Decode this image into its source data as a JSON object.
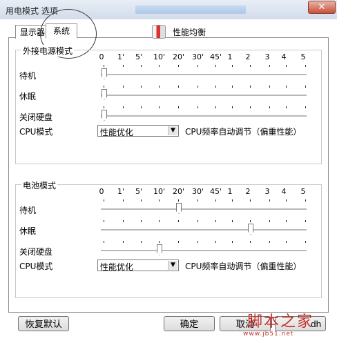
{
  "window": {
    "title": "用电模式 选项",
    "close_symbol": "✕"
  },
  "tabs": [
    {
      "label": "显示器"
    },
    {
      "label": "系统"
    }
  ],
  "header": {
    "label": "性能均衡",
    "icon": "power-balance-icon"
  },
  "tick_labels": [
    "0",
    "1'",
    "5'",
    "10'",
    "20'",
    "30'",
    "45'",
    "1",
    "2",
    "3",
    "4",
    "5"
  ],
  "ac_group": {
    "title": "外接电源模式",
    "rows": [
      {
        "label": "待机",
        "tick_index": 0
      },
      {
        "label": "休眠",
        "tick_index": 0
      },
      {
        "label": "关闭硬盘",
        "tick_index": 0
      }
    ],
    "cpu_label": "CPU模式",
    "cpu_selected": "性能优化",
    "cpu_desc": "CPU频率自动调节（偏重性能）"
  },
  "battery_group": {
    "title": "电池模式",
    "rows": [
      {
        "label": "待机",
        "tick_index": 4
      },
      {
        "label": "休眠",
        "tick_index": 8
      },
      {
        "label": "关闭硬盘",
        "tick_index": 3
      }
    ],
    "cpu_label": "CPU模式",
    "cpu_selected": "性能优化",
    "cpu_desc": "CPU频率自动调节（偏重性能）"
  },
  "buttons": {
    "restore": "恢复默认",
    "ok": "确定",
    "cancel": "取消",
    "apply": "dh"
  },
  "watermark": {
    "text": "脚本之家",
    "url": "www.jb51.net"
  }
}
